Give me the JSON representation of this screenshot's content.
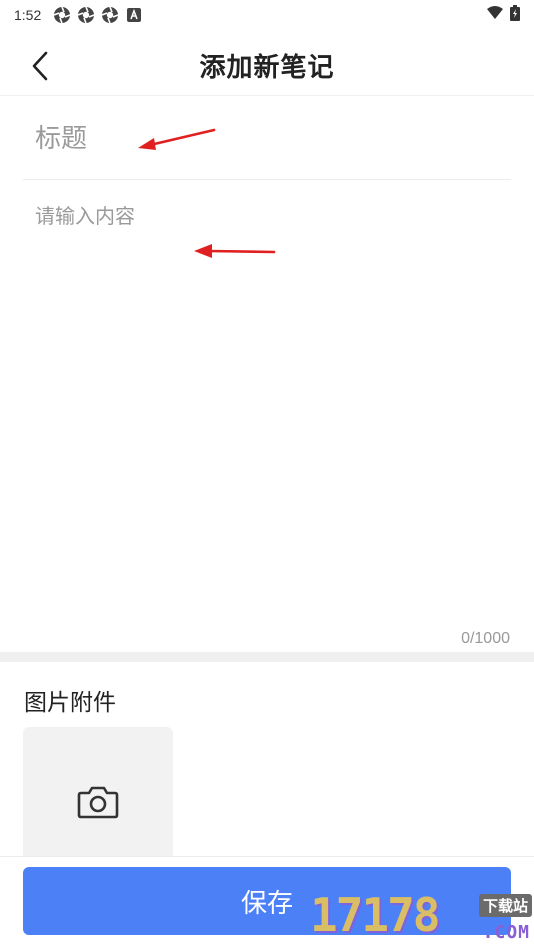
{
  "status_bar": {
    "time": "1:52",
    "left_icons": [
      "aperture-icon",
      "aperture-icon",
      "aperture-icon",
      "a-badge-icon"
    ],
    "right_icons": [
      "wifi-icon",
      "battery-icon"
    ]
  },
  "header": {
    "title": "添加新笔记",
    "back_icon": "chevron-left-icon"
  },
  "form": {
    "title_placeholder": "标题",
    "title_value": "",
    "content_placeholder": "请输入内容",
    "content_value": "",
    "char_count": "0/1000"
  },
  "attachments": {
    "heading": "图片附件",
    "add_icon": "camera-icon"
  },
  "actions": {
    "save_label": "保存"
  },
  "watermark": {
    "digits": "17178",
    "tag": "下载站",
    "domain": ".COM"
  },
  "colors": {
    "accent": "#4c80f7",
    "annotation_arrow": "#e02020",
    "placeholder": "#9a9a9a"
  }
}
